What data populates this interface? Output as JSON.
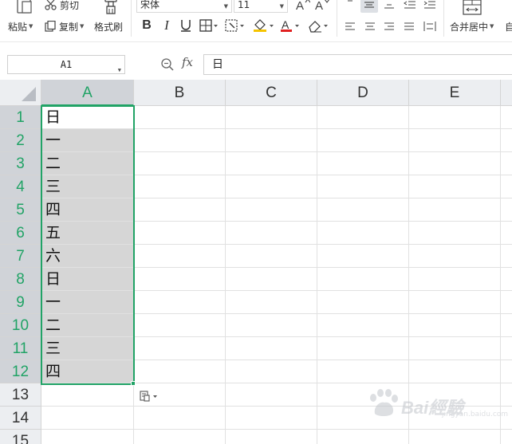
{
  "toolbar": {
    "paste_label": "粘贴",
    "cut_label": "剪切",
    "copy_label": "复制",
    "format_painter_label": "格式刷",
    "font_name": "宋体",
    "font_size": "11",
    "merge_center_label": "合并居中",
    "next_group_label": "自"
  },
  "formula_bar": {
    "name_box": "A1",
    "fx_label": "fx",
    "value": "日"
  },
  "sheet": {
    "columns": [
      "A",
      "B",
      "C",
      "D",
      "E"
    ],
    "selected_column": "A",
    "rows": [
      "1",
      "2",
      "3",
      "4",
      "5",
      "6",
      "7",
      "8",
      "9",
      "10",
      "11",
      "12",
      "13",
      "14",
      "15"
    ],
    "selected_rows": [
      "1",
      "2",
      "3",
      "4",
      "5",
      "6",
      "7",
      "8",
      "9",
      "10",
      "11",
      "12"
    ],
    "column_a_values": [
      "日",
      "一",
      "二",
      "三",
      "四",
      "五",
      "六",
      "日",
      "一",
      "二",
      "三",
      "四"
    ]
  },
  "colors": {
    "selection_accent": "#21a366",
    "selected_fill": "#d6d6d6",
    "header_bg": "#eceef1",
    "font_color_swatch": "#e02020",
    "fill_color_swatch": "#f5c400"
  },
  "watermark": {
    "text": "Bai經驗",
    "sub": "jingyan.baidu.com"
  }
}
